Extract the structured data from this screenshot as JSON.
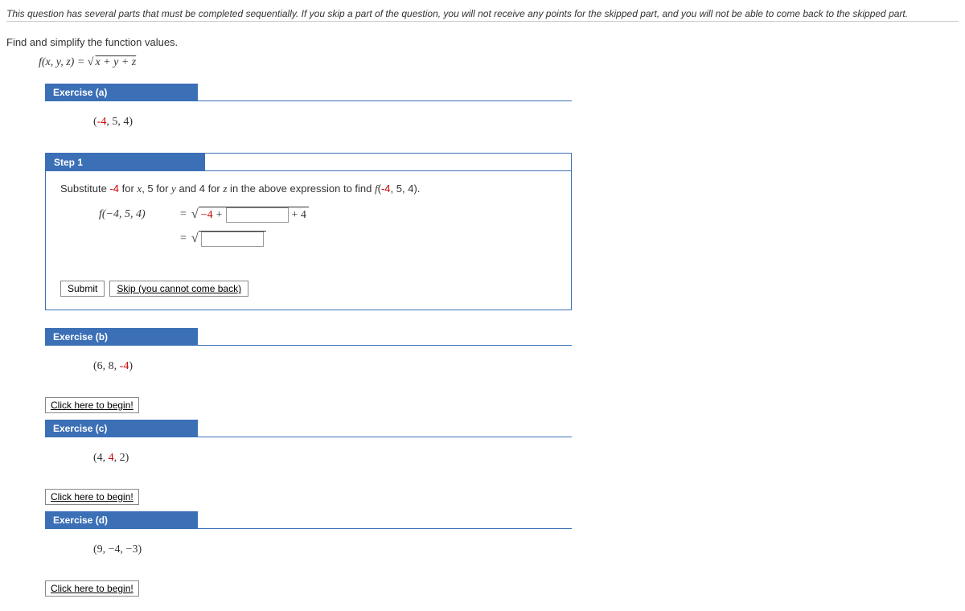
{
  "instructions": "This question has several parts that must be completed sequentially. If you skip a part of the question, you will not receive any points for the skipped part, and you will not be able to come back to the skipped part.",
  "prompt": "Find and simplify the function values.",
  "formula": {
    "lhs": "f(x, y, z) = ",
    "radicand": "x + y + z"
  },
  "exercises": {
    "a": {
      "label": "Exercise (a)",
      "value_prefix": "(",
      "value_red": "-4",
      "value_suffix": ", 5, 4)"
    },
    "b": {
      "label": "Exercise (b)",
      "value_prefix": "(6, 8, ",
      "value_red": "-4",
      "value_suffix": ")"
    },
    "c": {
      "label": "Exercise (c)",
      "value_prefix": "(4, ",
      "value_red": "4",
      "value_suffix": ", 2)"
    },
    "d": {
      "label": "Exercise (d)",
      "value_prefix": "(9, −4, −3)",
      "value_red": "",
      "value_suffix": ""
    }
  },
  "step1": {
    "label": "Step 1",
    "text_pre": "Substitute ",
    "text_red": "-4",
    "text_mid1": " for ",
    "text_x": "x",
    "text_mid2": ", 5 for ",
    "text_y": "y",
    "text_mid3": " and 4 for ",
    "text_z": "z",
    "text_mid4": " in the above expression to find ",
    "text_f": "f",
    "text_open": "(",
    "text_red2": "-4",
    "text_close": ", 5, 4).",
    "eq_lhs": "f(−4, 5, 4)",
    "eq_eq": " = ",
    "rad_prefix_red": "−4",
    "rad_prefix_plus": " + ",
    "rad_suffix": " + 4",
    "eq2_eq": " = "
  },
  "buttons": {
    "submit": "Submit",
    "skip": "Skip (you cannot come back)",
    "begin": "Click here to begin!"
  }
}
